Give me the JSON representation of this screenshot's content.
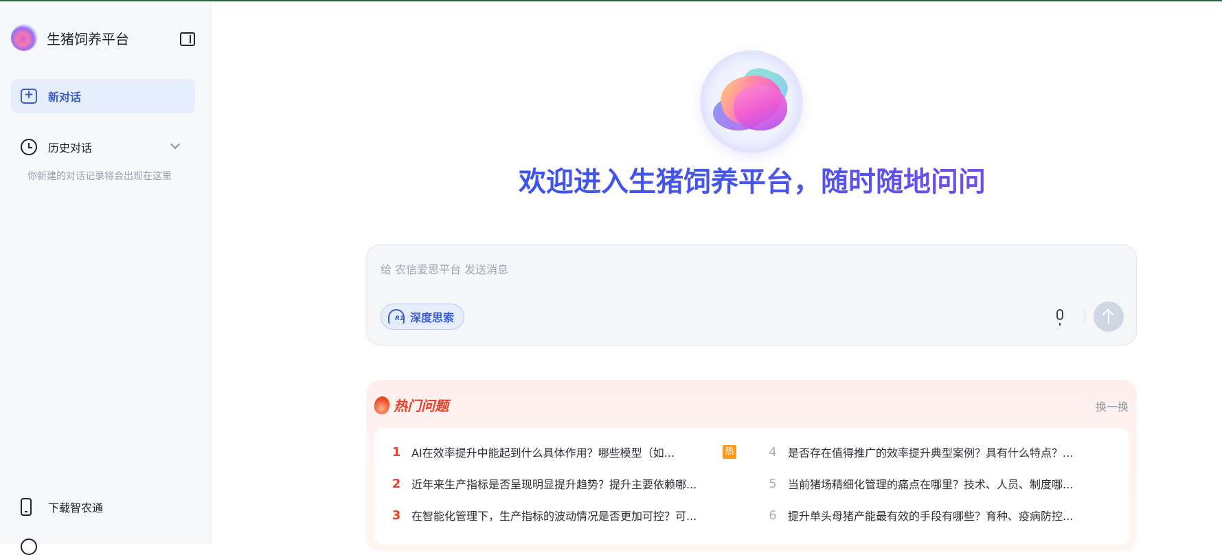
{
  "sidebar": {
    "brand_name": "生猪饲养平台",
    "new_chat_label": "新对话",
    "history_label": "历史对话",
    "history_empty": "你新建的对话记录将会出现在这里",
    "download_label": "下载智农通"
  },
  "main": {
    "welcome": "欢迎进入生猪饲养平台，随时随地问问",
    "composer": {
      "placeholder": "给 农信爱思平台 发送消息",
      "deep_think_label": "深度思索"
    },
    "hot": {
      "title": "热门问题",
      "swap_label": "换一换",
      "badge": "热",
      "questions": [
        {
          "num": "1",
          "text": "AI在效率提升中能起到什么具体作用？哪些模型（如..."
        },
        {
          "num": "2",
          "text": "近年来生产指标是否呈现明显提升趋势？提升主要依赖哪..."
        },
        {
          "num": "3",
          "text": "在智能化管理下，生产指标的波动情况是否更加可控？可..."
        },
        {
          "num": "4",
          "text": "是否存在值得推广的效率提升典型案例？具有什么特点？..."
        },
        {
          "num": "5",
          "text": "当前猪场精细化管理的痛点在哪里？技术、人员、制度哪..."
        },
        {
          "num": "6",
          "text": "提升单头母猪产能最有效的手段有哪些？育种、疫病防控..."
        }
      ]
    }
  },
  "colors": {
    "accent": "#3a5ccc",
    "hot_red": "#e8402a",
    "top_line": "#1f6b3a"
  }
}
